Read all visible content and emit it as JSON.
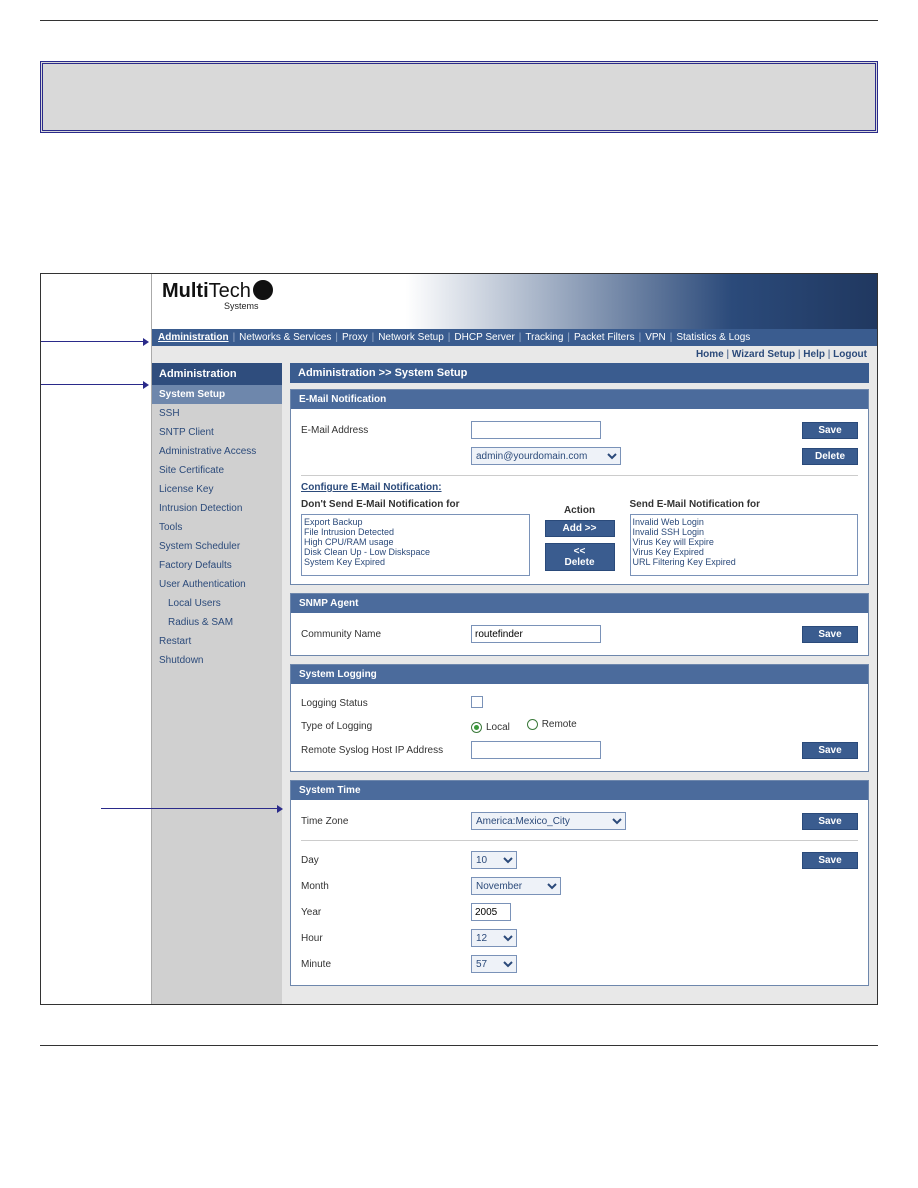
{
  "brand": {
    "name_a": "Multi",
    "name_b": "Tech",
    "sub": "Systems"
  },
  "menu": [
    "Administration",
    "Networks & Services",
    "Proxy",
    "Network Setup",
    "DHCP Server",
    "Tracking",
    "Packet Filters",
    "VPN",
    "Statistics & Logs"
  ],
  "menu_active": "Administration",
  "topright": [
    "Home",
    "Wizard Setup",
    "Help",
    "Logout"
  ],
  "sidebar": {
    "header": "Administration",
    "items": [
      {
        "label": "System Setup",
        "active": true
      },
      {
        "label": "SSH"
      },
      {
        "label": "SNTP Client"
      },
      {
        "label": "Administrative Access"
      },
      {
        "label": "Site Certificate"
      },
      {
        "label": "License Key"
      },
      {
        "label": "Intrusion Detection"
      },
      {
        "label": "Tools"
      },
      {
        "label": "System Scheduler"
      },
      {
        "label": "Factory Defaults"
      },
      {
        "label": "User Authentication"
      },
      {
        "label": "Local Users",
        "sub": true
      },
      {
        "label": "Radius & SAM",
        "sub": true
      },
      {
        "label": "Restart"
      },
      {
        "label": "Shutdown"
      }
    ]
  },
  "crumb": "Administration >> System Setup",
  "email": {
    "panel_title": "E-Mail Notification",
    "label": "E-Mail Address",
    "value": "",
    "saved_select": "admin@yourdomain.com",
    "save": "Save",
    "delete": "Delete",
    "config_title": "Configure E-Mail Notification:",
    "col1": "Don't Send E-Mail Notification for",
    "col2": "Action",
    "col3": "Send E-Mail Notification for",
    "left_list": [
      "Export Backup",
      "File Intrusion Detected",
      "High CPU/RAM usage",
      "Disk Clean Up - Low Diskspace",
      "System Key Expired"
    ],
    "right_list": [
      "Invalid Web Login",
      "Invalid SSH Login",
      "Virus Key will Expire",
      "Virus Key Expired",
      "URL Filtering Key Expired"
    ],
    "add": "Add >>",
    "del": "<< Delete"
  },
  "snmp": {
    "panel_title": "SNMP Agent",
    "label": "Community Name",
    "value": "routefinder",
    "save": "Save"
  },
  "logging": {
    "panel_title": "System Logging",
    "status_label": "Logging Status",
    "type_label": "Type of Logging",
    "local": "Local",
    "remote": "Remote",
    "remote_ip_label": "Remote Syslog Host IP Address",
    "remote_ip_value": "",
    "save": "Save"
  },
  "time": {
    "panel_title": "System Time",
    "tz_label": "Time Zone",
    "tz_value": "America:Mexico_City",
    "save": "Save",
    "day_label": "Day",
    "day_value": "10",
    "month_label": "Month",
    "month_value": "November",
    "year_label": "Year",
    "year_value": "2005",
    "hour_label": "Hour",
    "hour_value": "12",
    "minute_label": "Minute",
    "minute_value": "57"
  }
}
